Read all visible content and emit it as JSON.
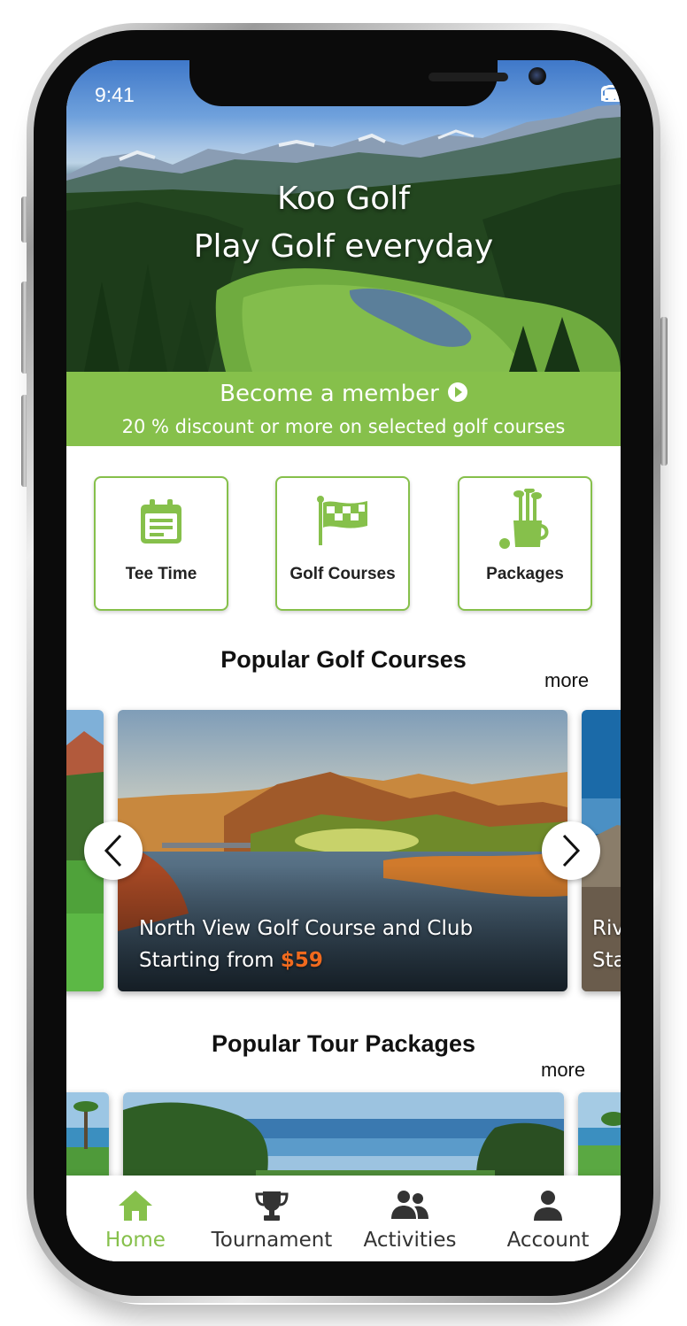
{
  "colors": {
    "accent": "#86c04b",
    "price": "#f06a1e",
    "text": "#111111",
    "inactive_tab": "#333333"
  },
  "status_bar": {
    "time": "9:41",
    "icons": [
      "signal-icon",
      "wifi-icon",
      "battery-icon"
    ]
  },
  "hero": {
    "title": "Koo Golf",
    "subtitle": "Play Golf everyday"
  },
  "member_banner": {
    "title": "Become a member",
    "subtitle": "20 % discount or more on selected golf courses",
    "icon": "play-circle-icon"
  },
  "quick_links": [
    {
      "label": "Tee Time",
      "icon": "calendar-icon"
    },
    {
      "label": "Golf Courses",
      "icon": "checkered-flag-icon"
    },
    {
      "label": "Packages",
      "icon": "golf-bag-icon"
    }
  ],
  "popular_courses": {
    "title": "Popular Golf Courses",
    "more_label": "more",
    "current": {
      "name": "North View Golf Course and Club",
      "price_prefix": "Starting from",
      "price": "$59"
    },
    "next_peek": {
      "name_fragment": "Riv",
      "price_fragment": "Sta"
    }
  },
  "popular_packages": {
    "title": "Popular Tour Packages",
    "more_label": "more"
  },
  "tabbar": {
    "active": "Home",
    "tabs": [
      {
        "label": "Home",
        "icon": "home-icon"
      },
      {
        "label": "Tournament",
        "icon": "trophy-icon"
      },
      {
        "label": "Activities",
        "icon": "people-icon"
      },
      {
        "label": "Account",
        "icon": "person-icon"
      }
    ]
  }
}
